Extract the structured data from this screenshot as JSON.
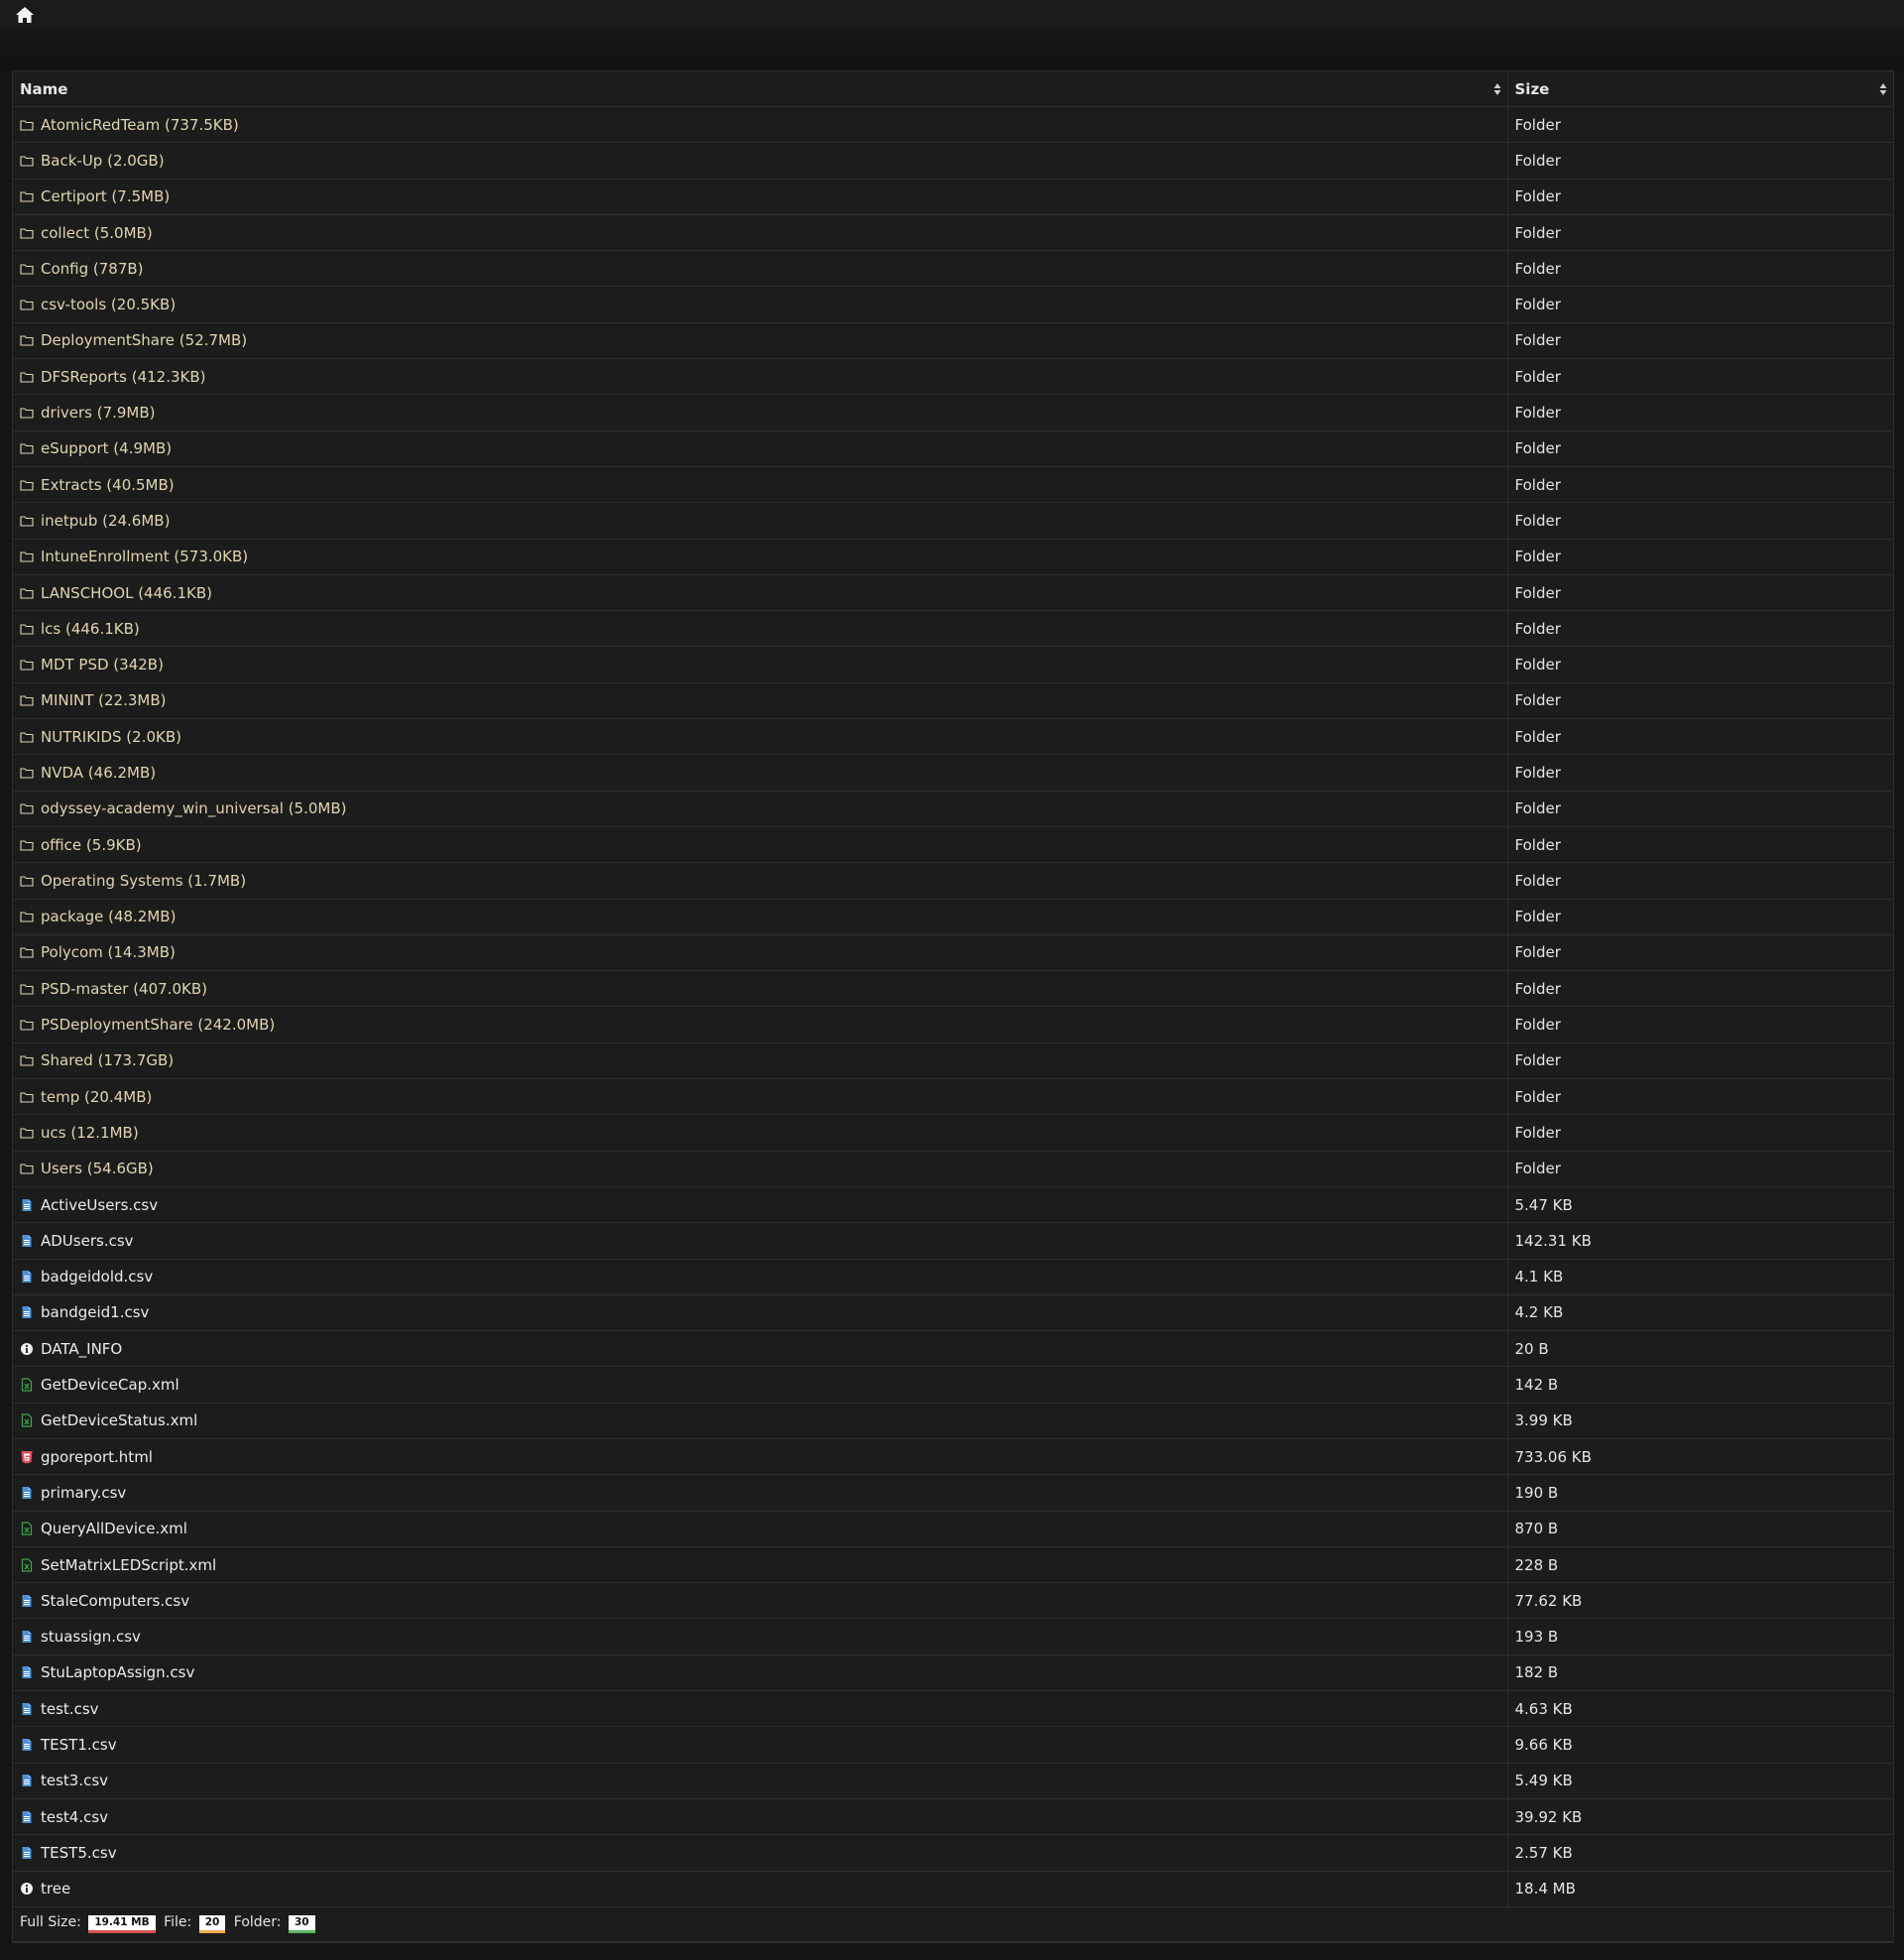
{
  "header": {
    "home_icon": "home-icon"
  },
  "table": {
    "columns": [
      {
        "label": "Name",
        "sort_icon": "sort-icon"
      },
      {
        "label": "Size",
        "sort_icon": "sort-icon"
      }
    ],
    "rows": [
      {
        "name": "AtomicRedTeam (737.5KB)",
        "size": "Folder",
        "type": "folder",
        "icon": "folder-icon"
      },
      {
        "name": "Back-Up (2.0GB)",
        "size": "Folder",
        "type": "folder",
        "icon": "folder-icon"
      },
      {
        "name": "Certiport (7.5MB)",
        "size": "Folder",
        "type": "folder",
        "icon": "folder-icon"
      },
      {
        "name": "collect (5.0MB)",
        "size": "Folder",
        "type": "folder",
        "icon": "folder-icon"
      },
      {
        "name": "Config (787B)",
        "size": "Folder",
        "type": "folder",
        "icon": "folder-icon"
      },
      {
        "name": "csv-tools (20.5KB)",
        "size": "Folder",
        "type": "folder",
        "icon": "folder-icon"
      },
      {
        "name": "DeploymentShare (52.7MB)",
        "size": "Folder",
        "type": "folder",
        "icon": "folder-icon"
      },
      {
        "name": "DFSReports (412.3KB)",
        "size": "Folder",
        "type": "folder",
        "icon": "folder-icon"
      },
      {
        "name": "drivers (7.9MB)",
        "size": "Folder",
        "type": "folder",
        "icon": "folder-icon"
      },
      {
        "name": "eSupport (4.9MB)",
        "size": "Folder",
        "type": "folder",
        "icon": "folder-icon"
      },
      {
        "name": "Extracts (40.5MB)",
        "size": "Folder",
        "type": "folder",
        "icon": "folder-icon"
      },
      {
        "name": "inetpub (24.6MB)",
        "size": "Folder",
        "type": "folder",
        "icon": "folder-icon"
      },
      {
        "name": "IntuneEnrollment (573.0KB)",
        "size": "Folder",
        "type": "folder",
        "icon": "folder-icon"
      },
      {
        "name": "LANSCHOOL (446.1KB)",
        "size": "Folder",
        "type": "folder",
        "icon": "folder-icon"
      },
      {
        "name": "lcs (446.1KB)",
        "size": "Folder",
        "type": "folder",
        "icon": "folder-icon"
      },
      {
        "name": "MDT PSD (342B)",
        "size": "Folder",
        "type": "folder",
        "icon": "folder-icon"
      },
      {
        "name": "MININT (22.3MB)",
        "size": "Folder",
        "type": "folder",
        "icon": "folder-icon"
      },
      {
        "name": "NUTRIKIDS (2.0KB)",
        "size": "Folder",
        "type": "folder",
        "icon": "folder-icon"
      },
      {
        "name": "NVDA (46.2MB)",
        "size": "Folder",
        "type": "folder",
        "icon": "folder-icon"
      },
      {
        "name": "odyssey-academy_win_universal (5.0MB)",
        "size": "Folder",
        "type": "folder",
        "icon": "folder-icon"
      },
      {
        "name": "office (5.9KB)",
        "size": "Folder",
        "type": "folder",
        "icon": "folder-icon"
      },
      {
        "name": "Operating Systems (1.7MB)",
        "size": "Folder",
        "type": "folder",
        "icon": "folder-icon"
      },
      {
        "name": "package (48.2MB)",
        "size": "Folder",
        "type": "folder",
        "icon": "folder-icon"
      },
      {
        "name": "Polycom (14.3MB)",
        "size": "Folder",
        "type": "folder",
        "icon": "folder-icon"
      },
      {
        "name": "PSD-master (407.0KB)",
        "size": "Folder",
        "type": "folder",
        "icon": "folder-icon"
      },
      {
        "name": "PSDeploymentShare (242.0MB)",
        "size": "Folder",
        "type": "folder",
        "icon": "folder-icon"
      },
      {
        "name": "Shared (173.7GB)",
        "size": "Folder",
        "type": "folder",
        "icon": "folder-icon"
      },
      {
        "name": "temp (20.4MB)",
        "size": "Folder",
        "type": "folder",
        "icon": "folder-icon"
      },
      {
        "name": "ucs (12.1MB)",
        "size": "Folder",
        "type": "folder",
        "icon": "folder-icon"
      },
      {
        "name": "Users (54.6GB)",
        "size": "Folder",
        "type": "folder",
        "icon": "folder-icon"
      },
      {
        "name": "ActiveUsers.csv",
        "size": "5.47 KB",
        "type": "csv",
        "icon": "csv-file-icon"
      },
      {
        "name": "ADUsers.csv",
        "size": "142.31 KB",
        "type": "csv",
        "icon": "csv-file-icon"
      },
      {
        "name": "badgeidold.csv",
        "size": "4.1 KB",
        "type": "csv",
        "icon": "csv-file-icon"
      },
      {
        "name": "bandgeid1.csv",
        "size": "4.2 KB",
        "type": "csv",
        "icon": "csv-file-icon"
      },
      {
        "name": "DATA_INFO",
        "size": "20 B",
        "type": "info",
        "icon": "info-icon"
      },
      {
        "name": "GetDeviceCap.xml",
        "size": "142 B",
        "type": "xml",
        "icon": "xml-file-icon"
      },
      {
        "name": "GetDeviceStatus.xml",
        "size": "3.99 KB",
        "type": "xml",
        "icon": "xml-file-icon"
      },
      {
        "name": "gporeport.html",
        "size": "733.06 KB",
        "type": "html",
        "icon": "html5-icon"
      },
      {
        "name": "primary.csv",
        "size": "190 B",
        "type": "csv",
        "icon": "csv-file-icon"
      },
      {
        "name": "QueryAllDevice.xml",
        "size": "870 B",
        "type": "xml",
        "icon": "xml-file-icon"
      },
      {
        "name": "SetMatrixLEDScript.xml",
        "size": "228 B",
        "type": "xml",
        "icon": "xml-file-icon"
      },
      {
        "name": "StaleComputers.csv",
        "size": "77.62 KB",
        "type": "csv",
        "icon": "csv-file-icon"
      },
      {
        "name": "stuassign.csv",
        "size": "193 B",
        "type": "csv",
        "icon": "csv-file-icon"
      },
      {
        "name": "StuLaptopAssign.csv",
        "size": "182 B",
        "type": "csv",
        "icon": "csv-file-icon"
      },
      {
        "name": "test.csv",
        "size": "4.63 KB",
        "type": "csv",
        "icon": "csv-file-icon"
      },
      {
        "name": "TEST1.csv",
        "size": "9.66 KB",
        "type": "csv",
        "icon": "csv-file-icon"
      },
      {
        "name": "test3.csv",
        "size": "5.49 KB",
        "type": "csv",
        "icon": "csv-file-icon"
      },
      {
        "name": "test4.csv",
        "size": "39.92 KB",
        "type": "csv",
        "icon": "csv-file-icon"
      },
      {
        "name": "TEST5.csv",
        "size": "2.57 KB",
        "type": "csv",
        "icon": "csv-file-icon"
      },
      {
        "name": "tree",
        "size": "18.4 MB",
        "type": "info",
        "icon": "info-icon"
      }
    ]
  },
  "footer": {
    "full_size_label": "Full Size:",
    "full_size_value": "19.41 MB",
    "file_label": "File:",
    "file_count": "20",
    "folder_label": "Folder:",
    "folder_count": "30"
  },
  "colors": {
    "background": "#141414",
    "folder_text": "#e3d4b0",
    "csv_icon": "#4a90d9",
    "xml_icon": "#3fa34d",
    "html_icon": "#e0525a"
  }
}
